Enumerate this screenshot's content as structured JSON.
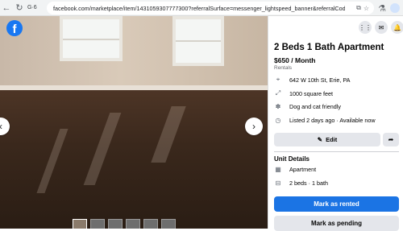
{
  "browser": {
    "tab_count": "G·6",
    "url": "facebook.com/marketplace/item/1431059307777300?referralSurface=messenger_lightspeed_banner&referralCode=messeng...",
    "icons": [
      "back-icon",
      "reload-icon",
      "extension-icon",
      "star-icon",
      "lab-icon"
    ]
  },
  "photo": {
    "logo": "f",
    "prev_icon": "‹",
    "next_icon": "›",
    "thumbnail_count": 6
  },
  "panel": {
    "title": "2 Beds 1 Bath Apartment",
    "price": "$650 / Month",
    "category": "Rentals",
    "details": [
      {
        "icon": "location-pin-icon",
        "text": "642 W 10th St, Erie, PA"
      },
      {
        "icon": "square-feet-icon",
        "text": "1000 square feet"
      },
      {
        "icon": "pet-paw-icon",
        "text": "Dog and cat friendly"
      },
      {
        "icon": "clock-icon",
        "text": "Listed 2 days ago · Available now"
      }
    ],
    "edit_label": "Edit",
    "unit_details_title": "Unit Details",
    "unit_details": [
      {
        "icon": "building-icon",
        "text": "Apartment"
      },
      {
        "icon": "bed-icon",
        "text": "2 beds · 1 bath"
      }
    ],
    "mark_rented_label": "Mark as rented",
    "mark_pending_label": "Mark as pending"
  },
  "colors": {
    "brand_blue": "#1b74e4",
    "facebook_blue": "#1877f2",
    "button_gray": "#e4e6eb"
  }
}
